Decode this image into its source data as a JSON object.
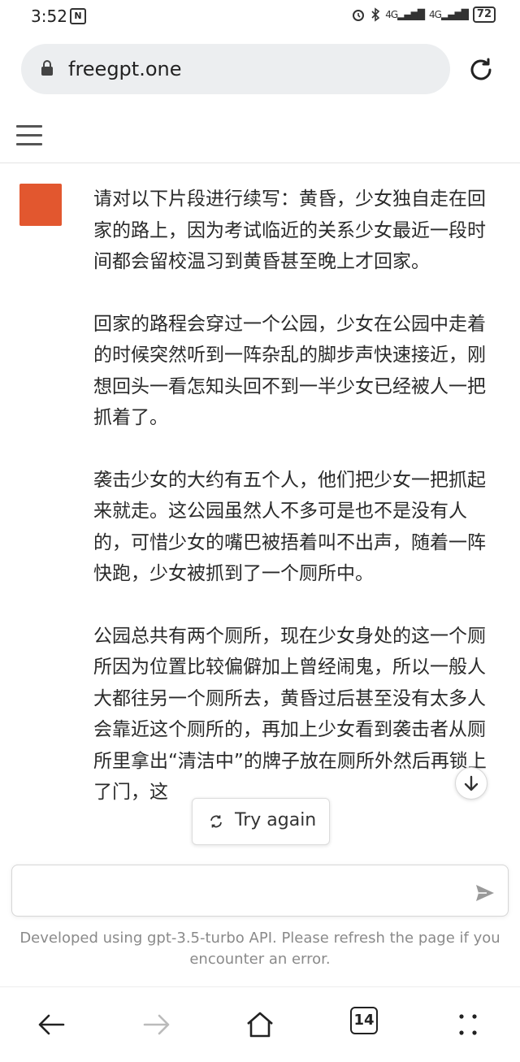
{
  "status_bar": {
    "time": "3:52",
    "notification_badge": "N",
    "network_labels": [
      "4G",
      "4G"
    ],
    "battery": "72"
  },
  "browser": {
    "url": "freegpt.one",
    "tab_count": "14"
  },
  "message": {
    "paragraphs": [
      "请对以下片段进行续写：黄昏，少女独自走在回家的路上，因为考试临近的关系少女最近一段时间都会留校温习到黄昏甚至晚上才回家。",
      "回家的路程会穿过一个公园，少女在公园中走着的时候突然听到一阵杂乱的脚步声快速接近，刚想回头一看怎知头回不到一半少女已经被人一把抓着了。",
      "袭击少女的大约有五个人，他们把少女一把抓起来就走。这公园虽然人不多可是也不是没有人的，可惜少女的嘴巴被捂着叫不出声，随着一阵快跑，少女被抓到了一个厕所中。",
      "公园总共有两个厕所，现在少女身处的这一个厕所因为位置比较偏僻加上曾经闹鬼，所以一般人大都往另一个厕所去，黄昏过后甚至没有太多人会靠近这个厕所的，再加上少女看到袭击者从厕所里拿出“清洁中”的牌子放在厕所外然后再锁上了门，这"
    ]
  },
  "actions": {
    "try_again_label": "Try again"
  },
  "input": {
    "placeholder": ""
  },
  "footer": {
    "note": "Developed using gpt-3.5-turbo API. Please refresh the page if you encounter an error."
  },
  "colors": {
    "avatar": "#e2572f",
    "url_bar_bg": "#eceef0"
  }
}
